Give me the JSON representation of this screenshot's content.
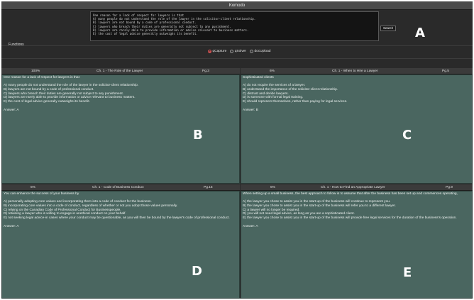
{
  "window": {
    "title": "Komodo"
  },
  "search": {
    "query": "One reason for a lack of respect for lawyers is that\nA) many people do not understand the role of the lawyer in the solicitor-client relationship.\nB) lawyers are not bound by a code of professional conduct.\nC) lawyers who breach their duties are generally not subject to any punishment.\nD) lawyers are rarely able to provide information or advice relevant to business matters.\nE) the cost of legal advice generally outweighs its benefit.",
    "button_label": "Search"
  },
  "functions": {
    "label": "Functions",
    "options": [
      {
        "label": "qCapture",
        "selected": true
      },
      {
        "label": "qSolver",
        "selected": false
      },
      {
        "label": "docUpload",
        "selected": false
      }
    ]
  },
  "annotations": {
    "a": "A",
    "b": "B",
    "c": "C",
    "d": "D",
    "e": "E"
  },
  "panels": [
    {
      "percent": "100%",
      "chapter": "Ch. 1 - The Role of the Lawyer",
      "page": "Pg.3",
      "question": "One reason for a lack of respect for lawyers is that",
      "options": [
        "A) many people do not understand the role of the lawyer in the solicitor-client relationship.",
        "B) lawyers are not bound by a code of professional conduct.",
        "C) lawyers who breach their duties are generally not subject to any punishment.",
        "D) lawyers are rarely able to provide information or advice relevant to business matters.",
        "E) the cost of legal advice generally outweighs its benefit."
      ],
      "answer": "Answer: A"
    },
    {
      "percent": "6%",
      "chapter": "Ch. 1 - When to Hire a Lawyer",
      "page": "Pg.5",
      "question": "Sophisticated clients",
      "options": [
        "A) do not require the services of a lawyer.",
        "B) understand the importance of the solicitor-client relationship.",
        "C) distrust and deride lawyers.",
        "D) is someone with formal legal training.",
        "E) should represent themselves, rather than paying for legal services."
      ],
      "answer": "Answer: B"
    },
    {
      "percent": "5%",
      "chapter": "Ch. 1 - Code of Business Conduct",
      "page": "Pg.15",
      "question": "You can enhance the success of your business by",
      "options": [
        "A) personally adopting core values and incorporating them into a code of conduct for the business.",
        "B) incorporating core values into a code of conduct, regardless of whether or not you adopt those values personally.",
        "C) relying on the Canadian Code of Professional Conduct for Businesspeople.",
        "D) retaining a lawyer who is willing to engage in unethical conduct on your behalf.",
        "E) not seeking legal advice-in cases where your conduct may be questionable, as you will then be bound by the lawyer's code of professional conduct."
      ],
      "answer": "Answer: A"
    },
    {
      "percent": "5%",
      "chapter": "Ch. 1 - How to Find an Appropriate Lawyer",
      "page": "Pg.9",
      "question": "When setting up a small business, the best approach to follow is to assume that after the business has been set up and commences operating,",
      "options": [
        "A) the lawyer you chose to assist you in the start-up of the business will continue to represent you.",
        "B) the lawyer you chose to assist you in the start-up of the business will refer you to a different lawyer.",
        "C) a lawyer will no longer be required.",
        "D) you will not need legal advice, as long as you are a sophisticated client.",
        "E) the lawyer you chose to assist you in the start-up of the business will provide free legal services for the duration of the business's operation."
      ],
      "answer": "Answer: A"
    }
  ]
}
